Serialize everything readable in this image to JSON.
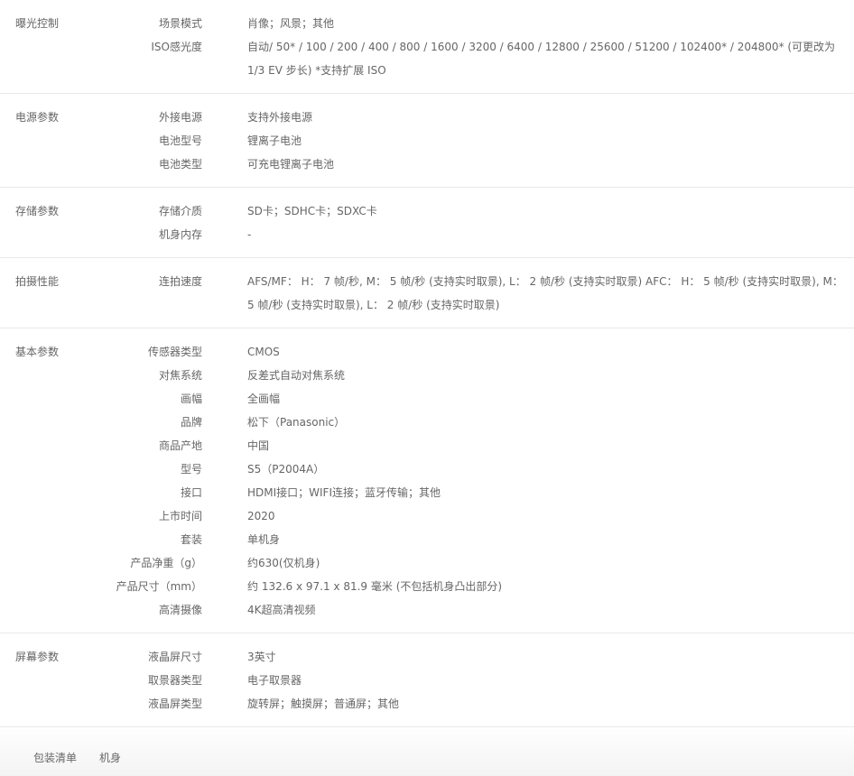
{
  "groups": [
    {
      "title": "曝光控制",
      "rows": [
        {
          "label": "场景模式",
          "value": "肖像；风景；其他"
        },
        {
          "label": "ISO感光度",
          "value": "自动/ 50* / 100 / 200 / 400 / 800 / 1600 / 3200 / 6400 / 12800 / 25600 / 51200 / 102400* / 204800* (可更改为 1/3 EV 步长) *支持扩展 ISO"
        }
      ]
    },
    {
      "title": "电源参数",
      "rows": [
        {
          "label": "外接电源",
          "value": "支持外接电源"
        },
        {
          "label": "电池型号",
          "value": "锂离子电池"
        },
        {
          "label": "电池类型",
          "value": "可充电锂离子电池"
        }
      ]
    },
    {
      "title": "存储参数",
      "rows": [
        {
          "label": "存储介质",
          "value": "SD卡；SDHC卡；SDXC卡"
        },
        {
          "label": "机身内存",
          "value": "-"
        }
      ]
    },
    {
      "title": "拍摄性能",
      "rows": [
        {
          "label": "连拍速度",
          "value": "AFS/MF： H： 7 帧/秒, M： 5 帧/秒 (支持实时取景), L： 2 帧/秒 (支持实时取景) AFC： H： 5 帧/秒 (支持实时取景), M： 5 帧/秒 (支持实时取景), L： 2 帧/秒 (支持实时取景)"
        }
      ]
    },
    {
      "title": "基本参数",
      "rows": [
        {
          "label": "传感器类型",
          "value": "CMOS"
        },
        {
          "label": "对焦系统",
          "value": "反差式自动对焦系统"
        },
        {
          "label": "画幅",
          "value": "全画幅"
        },
        {
          "label": "品牌",
          "value": "松下（Panasonic）"
        },
        {
          "label": "商品产地",
          "value": "中国"
        },
        {
          "label": "型号",
          "value": "S5（P2004A）"
        },
        {
          "label": "接口",
          "value": "HDMI接口；WIFI连接；蓝牙传输；其他"
        },
        {
          "label": "上市时间",
          "value": "2020"
        },
        {
          "label": "套装",
          "value": "单机身"
        },
        {
          "label": "产品净重（g）",
          "value": "约630(仅机身)"
        },
        {
          "label": "产品尺寸（mm）",
          "value": "约 132.6 x 97.1 x 81.9 毫米 (不包括机身凸出部分)"
        },
        {
          "label": "高清摄像",
          "value": "4K超高清视频"
        }
      ]
    },
    {
      "title": "屏幕参数",
      "rows": [
        {
          "label": "液晶屏尺寸",
          "value": "3英寸"
        },
        {
          "label": "取景器类型",
          "value": "电子取景器"
        },
        {
          "label": "液晶屏类型",
          "value": "旋转屏；触摸屏；普通屏；其他"
        }
      ]
    }
  ],
  "package": {
    "label": "包装清单",
    "value": "机身"
  }
}
